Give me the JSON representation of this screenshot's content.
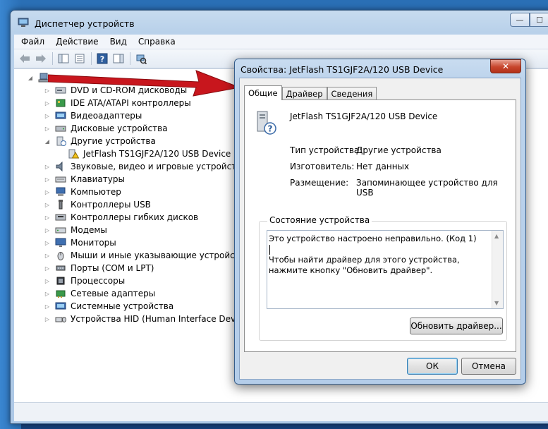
{
  "window": {
    "title": "Диспетчер устройств",
    "minimize": "—",
    "maximize": "☐"
  },
  "menu": [
    "Файл",
    "Действие",
    "Вид",
    "Справка"
  ],
  "tree": [
    {
      "label": "DVD и CD-ROM дисководы"
    },
    {
      "label": "IDE ATA/ATAPI контроллеры"
    },
    {
      "label": "Видеоадаптеры"
    },
    {
      "label": "Дисковые устройства"
    },
    {
      "label": "Другие устройства"
    },
    {
      "label": "JetFlash TS1GJF2A/120 USB Device"
    },
    {
      "label": "Звуковые, видео и игровые устройства"
    },
    {
      "label": "Клавиатуры"
    },
    {
      "label": "Компьютер"
    },
    {
      "label": "Контроллеры USB"
    },
    {
      "label": "Контроллеры гибких дисков"
    },
    {
      "label": "Модемы"
    },
    {
      "label": "Мониторы"
    },
    {
      "label": "Мыши и иные указывающие устройства"
    },
    {
      "label": "Порты (COM и LPT)"
    },
    {
      "label": "Процессоры"
    },
    {
      "label": "Сетевые адаптеры"
    },
    {
      "label": "Системные устройства"
    },
    {
      "label": "Устройства HID (Human Interface Devices)"
    }
  ],
  "dialog": {
    "title": "Свойства: JetFlash TS1GJF2A/120 USB Device",
    "close": "✕",
    "tabs": [
      "Общие",
      "Драйвер",
      "Сведения"
    ],
    "device_name": "JetFlash TS1GJF2A/120 USB Device",
    "props": {
      "type_label": "Тип устройства:",
      "type_value": "Другие устройства",
      "maker_label": "Изготовитель:",
      "maker_value": "Нет данных",
      "loc_label": "Размещение:",
      "loc_value": "Запоминающее устройство для USB"
    },
    "status_group_title": "Состояние устройства",
    "status_line1": "Это устройство настроено неправильно. (Код 1)",
    "status_line2": "Чтобы найти драйвер для этого устройства, нажмите кнопку \"Обновить драйвер\".",
    "update_button": "Обновить драйвер...",
    "ok_button": "ОК",
    "cancel_button": "Отмена"
  },
  "colors": {
    "arrow": "#c8161d",
    "desktop": "#1e5a9e"
  }
}
